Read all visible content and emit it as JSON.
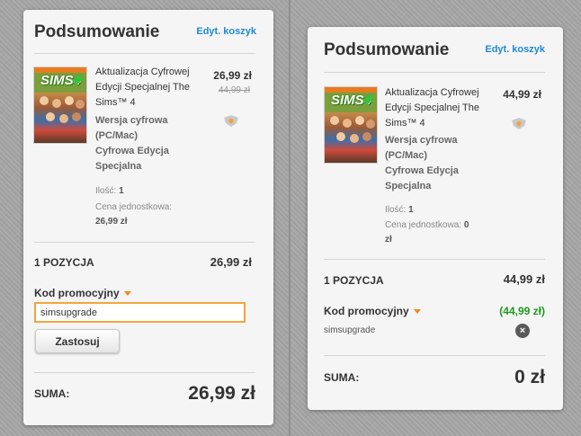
{
  "left_panel": {
    "title": "Podsumowanie",
    "edit_link": "Edyt. koszyk",
    "product": {
      "logo_text": "SIMS4",
      "name_lines": [
        "Aktualizacja Cyfrowej",
        "Edycji Specjalnej The",
        "Sims™ 4"
      ],
      "sub_lines": [
        "Wersja cyfrowa",
        "(PC/Mac)",
        "Cyfrowa Edycja",
        "Specjalna"
      ],
      "qty_label": "Ilość:",
      "qty_value": "1",
      "unit_price_label": "Cena jednostkowa:",
      "unit_price_value": "26,99 zł",
      "price": "26,99 zł",
      "old_price": "44,99 zł"
    },
    "items_label": "1 POZYCJA",
    "items_total": "26,99 zł",
    "promo_label": "Kod promocyjny",
    "promo_input_value": "simsupgrade",
    "apply_button": "Zastosuj",
    "sum_label": "SUMA:",
    "sum_value": "26,99 zł"
  },
  "right_panel": {
    "title": "Podsumowanie",
    "edit_link": "Edyt. koszyk",
    "product": {
      "logo_text": "SIMS4",
      "name_lines": [
        "Aktualizacja Cyfrowej",
        "Edycji Specjalnej The",
        "Sims™ 4"
      ],
      "sub_lines": [
        "Wersja cyfrowa",
        "(PC/Mac)",
        "Cyfrowa Edycja",
        "Specjalna"
      ],
      "qty_label": "Ilość:",
      "qty_value": "1",
      "unit_price_label": "Cena jednostkowa:",
      "unit_price_value": "0",
      "unit_price_value_2": "zł",
      "price": "44,99 zł"
    },
    "items_label": "1 POZYCJA",
    "items_total": "44,99 zł",
    "promo_label": "Kod promocyjny",
    "promo_discount": "(44,99 zł)",
    "promo_code": "simsupgrade",
    "sum_label": "SUMA:",
    "sum_value": "0 zł"
  },
  "colors": {
    "accent_link": "#1d8ad6",
    "caret": "#f08a1c",
    "discount_green": "#1d9a1d",
    "input_border": "#f3a53d"
  }
}
